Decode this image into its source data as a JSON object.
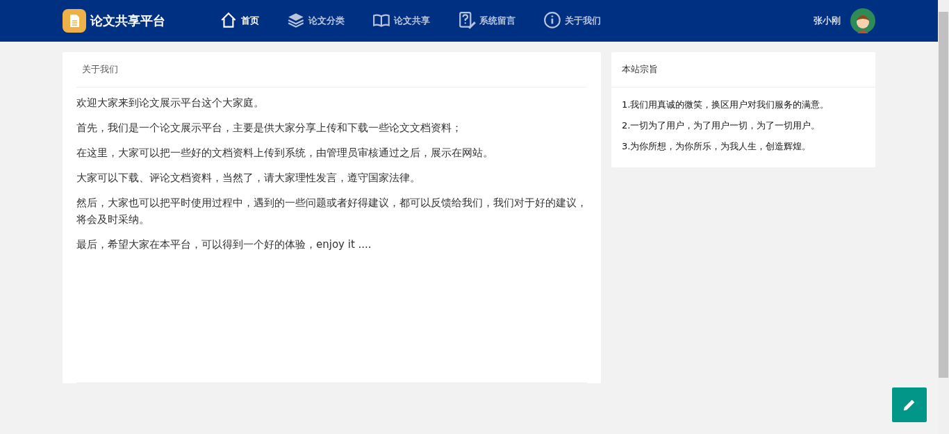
{
  "header": {
    "logo_text": "论文共享平台",
    "nav": [
      {
        "label": "首页",
        "kind": "home",
        "selected": true
      },
      {
        "label": "论文分类",
        "kind": "layers",
        "selected": false
      },
      {
        "label": "论文共享",
        "kind": "book",
        "selected": false
      },
      {
        "label": "系统留言",
        "kind": "question",
        "selected": false
      },
      {
        "label": "关于我们",
        "kind": "info",
        "selected": false
      }
    ],
    "user_name": "张小刚"
  },
  "about": {
    "title": "关于我们",
    "paragraphs": [
      "欢迎大家来到论文展示平台这个大家庭。",
      "首先，我们是一个论文展示平台，主要是供大家分享上传和下载一些论文文档资料；",
      "在这里，大家可以把一些好的文档资料上传到系统，由管理员审核通过之后，展示在网站。",
      "大家可以下载、评论文档资料，当然了，请大家理性发言，遵守国家法律。",
      "然后，大家也可以把平时使用过程中，遇到的一些问题或者好得建议，都可以反馈给我们，我们对于好的建议，将会及时采纳。",
      "最后，希望大家在本平台，可以得到一个好的体验，enjoy it ...."
    ]
  },
  "purpose": {
    "title": "本站宗旨",
    "items": [
      "1.我们用真诚的微笑，换区用户对我们服务的满意。",
      "2.一切为了用户，为了用户一切，为了一切用户。",
      "3.为你所想，为你所乐，为我人生，创造辉煌。"
    ]
  }
}
